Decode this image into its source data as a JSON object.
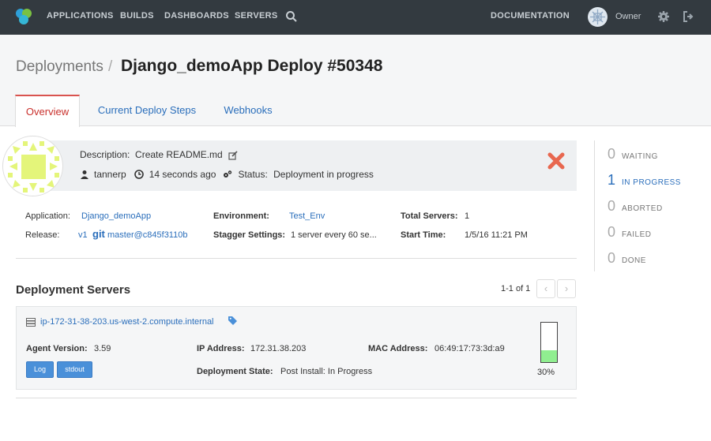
{
  "nav": {
    "items": [
      "APPLICATIONS",
      "BUILDS",
      "DASHBOARDS",
      "SERVERS"
    ],
    "documentation": "DOCUMENTATION",
    "user": "Owner"
  },
  "header": {
    "breadcrumb": "Deployments",
    "separator": "/",
    "title": "Django_demoApp Deploy #50348",
    "tabs": [
      "Overview",
      "Current Deploy Steps",
      "Webhooks"
    ]
  },
  "summary": {
    "description_label": "Description:",
    "description": "Create README.md",
    "user": "tannerp",
    "time": "14 seconds ago",
    "status_label": "Status:",
    "status": "Deployment in progress"
  },
  "details": {
    "application_label": "Application:",
    "application": "Django_demoApp",
    "release_label": "Release:",
    "release_version": "v1",
    "git_label": "git",
    "release_ref": "master@c845f3110b",
    "environment_label": "Environment:",
    "environment": "Test_Env",
    "stagger_label": "Stagger Settings:",
    "stagger": "1 server every 60 se...",
    "total_servers_label": "Total Servers:",
    "total_servers": "1",
    "start_time_label": "Start Time:",
    "start_time": "1/5/16 11:21 PM"
  },
  "status_counts": [
    {
      "count": "0",
      "label": "WAITING"
    },
    {
      "count": "1",
      "label": "IN PROGRESS"
    },
    {
      "count": "0",
      "label": "ABORTED"
    },
    {
      "count": "0",
      "label": "FAILED"
    },
    {
      "count": "0",
      "label": "DONE"
    }
  ],
  "servers": {
    "title": "Deployment Servers",
    "pagination": "1-1 of 1",
    "prev": "‹",
    "next": "›",
    "items": [
      {
        "hostname": "ip-172-31-38-203.us-west-2.compute.internal",
        "agent_label": "Agent Version:",
        "agent_version": "3.59",
        "ip_label": "IP Address:",
        "ip": "172.31.38.203",
        "mac_label": "MAC Address:",
        "mac": "06:49:17:73:3d:a9",
        "state_label": "Deployment State:",
        "state": "Post Install: In Progress",
        "log_button": "Log",
        "stdout_button": "stdout",
        "progress_text": "30%",
        "progress": 0.3
      }
    ]
  },
  "colors": {
    "accent": "#2a6ebb",
    "danger": "#e8674f",
    "progress": "#90ee90",
    "nav_bg": "#333a40"
  }
}
